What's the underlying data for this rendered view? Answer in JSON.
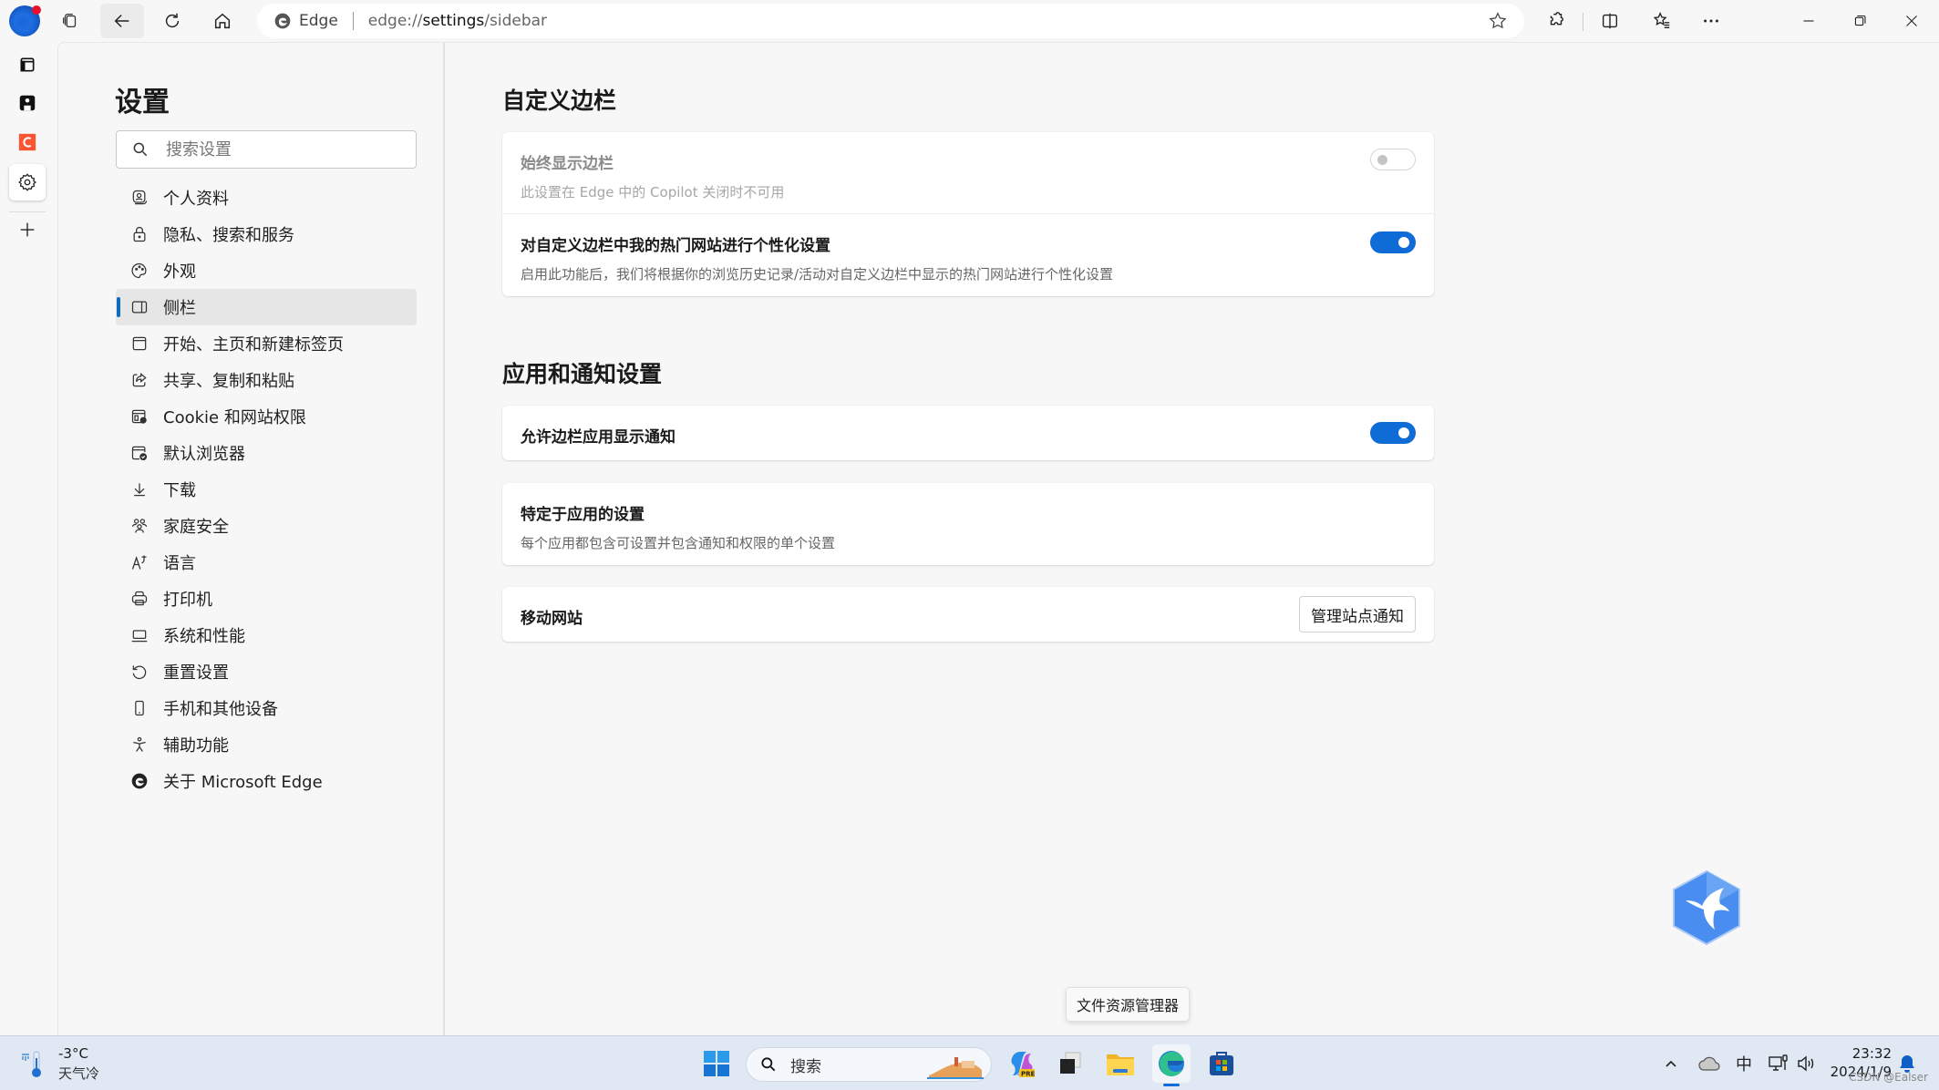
{
  "browser": {
    "site_label": "Edge",
    "url_prefix": "edge://",
    "url_bold": "settings",
    "url_suffix": "/sidebar",
    "window_controls": [
      "minimize",
      "restore",
      "close"
    ]
  },
  "strip": {
    "items": [
      "tab-actions",
      "app-icon",
      "csdn-app",
      "settings",
      "add"
    ]
  },
  "nav": {
    "title": "设置",
    "search_placeholder": "搜索设置",
    "items": [
      {
        "label": "个人资料",
        "icon": "profile-icon"
      },
      {
        "label": "隐私、搜索和服务",
        "icon": "lock-icon"
      },
      {
        "label": "外观",
        "icon": "palette-icon"
      },
      {
        "label": "侧栏",
        "icon": "sidebar-icon",
        "active": true
      },
      {
        "label": "开始、主页和新建标签页",
        "icon": "newtab-icon"
      },
      {
        "label": "共享、复制和粘贴",
        "icon": "share-icon"
      },
      {
        "label": "Cookie 和网站权限",
        "icon": "cookie-settings-icon"
      },
      {
        "label": "默认浏览器",
        "icon": "default-browser-icon"
      },
      {
        "label": "下载",
        "icon": "download-icon"
      },
      {
        "label": "家庭安全",
        "icon": "family-icon"
      },
      {
        "label": "语言",
        "icon": "language-icon"
      },
      {
        "label": "打印机",
        "icon": "printer-icon"
      },
      {
        "label": "系统和性能",
        "icon": "laptop-icon"
      },
      {
        "label": "重置设置",
        "icon": "reset-icon"
      },
      {
        "label": "手机和其他设备",
        "icon": "phone-icon"
      },
      {
        "label": "辅助功能",
        "icon": "accessibility-icon"
      },
      {
        "label": "关于 Microsoft Edge",
        "icon": "edge-logo-icon"
      }
    ]
  },
  "main": {
    "section1": {
      "title": "自定义边栏",
      "rows": [
        {
          "title": "始终显示边栏",
          "desc": "此设置在 Edge 中的 Copilot 关闭时不可用",
          "toggle": false,
          "disabled": true
        },
        {
          "title": "对自定义边栏中我的热门网站进行个性化设置",
          "desc": "启用此功能后，我们将根据你的浏览历史记录/活动对自定义边栏中显示的热门网站进行个性化设置",
          "toggle": true,
          "disabled": false
        }
      ]
    },
    "section2": {
      "title": "应用和通知设置",
      "allow_notifications": {
        "title": "允许边栏应用显示通知",
        "toggle": true
      },
      "app_specific": {
        "title": "特定于应用的设置",
        "desc": "每个应用都包含可设置并包含通知和权限的单个设置"
      },
      "mobile_sites": {
        "title": "移动网站",
        "button": "管理站点通知"
      }
    }
  },
  "tooltip": "文件资源管理器",
  "taskbar": {
    "weather": {
      "temp": "-3°C",
      "condition": "天气冷"
    },
    "search_placeholder": "搜索",
    "ime": "中",
    "time": "23:32",
    "date": "2024/1/9",
    "watermark": "CSDN @Ealser"
  },
  "colors": {
    "accent": "#0f6cd6",
    "page_bg": "#f7f7f7",
    "taskbar_bg": "#dfe8f3"
  }
}
